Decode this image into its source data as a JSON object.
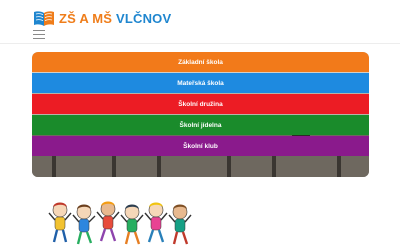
{
  "header": {
    "logo_text_part1": "ZŠ A MŠ ",
    "logo_text_part2": "VLČNOV",
    "logo_icon": "open-book-icon",
    "menu_icon": "hamburger-menu-icon"
  },
  "nav": {
    "items": [
      {
        "label": "Základní škola",
        "color": "#f27a1a"
      },
      {
        "label": "Mateřská škola",
        "color": "#1e8ae0"
      },
      {
        "label": "Školní družina",
        "color": "#ec1c24"
      },
      {
        "label": "Školní jídelna",
        "color": "#1a8b2b"
      },
      {
        "label": "Školní klub",
        "color": "#8a1a8c"
      }
    ]
  },
  "colors": {
    "brand_orange": "#ef7d1a",
    "brand_blue": "#1f86cf"
  },
  "illustration": {
    "name": "children-jumping-illustration"
  }
}
